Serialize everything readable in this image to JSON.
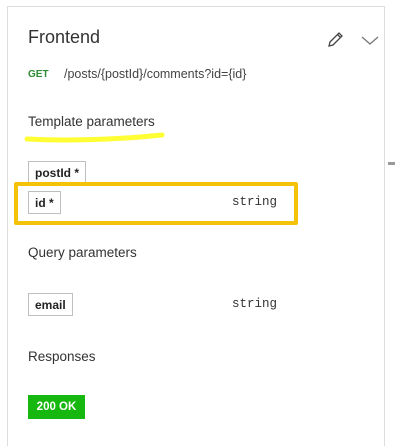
{
  "header": {
    "title": "Frontend"
  },
  "operation": {
    "method": "GET",
    "path": "/posts/{postId}/comments?id={id}"
  },
  "template_parameters": {
    "title": "Template parameters",
    "items": [
      {
        "name": "postId *",
        "type": ""
      },
      {
        "name": "id *",
        "type": "string"
      }
    ]
  },
  "query_parameters": {
    "title": "Query parameters",
    "items": [
      {
        "name": "email",
        "type": "string"
      }
    ]
  },
  "responses": {
    "title": "Responses",
    "status": "200 OK"
  },
  "colors": {
    "highlight": "#f5c20a",
    "annotation": "#ffff33",
    "method_get": "#2e8b32",
    "status_ok": "#16b70f"
  },
  "icons": [
    "pencil-icon",
    "chevron-down-icon"
  ]
}
